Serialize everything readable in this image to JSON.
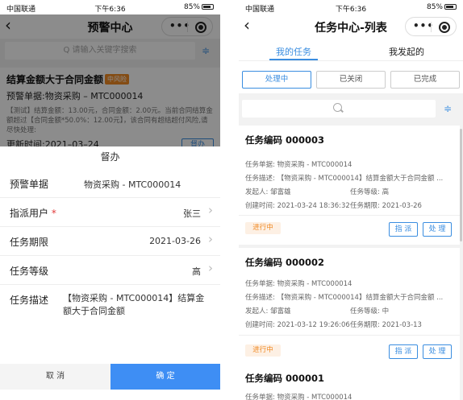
{
  "left": {
    "status": {
      "carrier": "中国联通",
      "time": "下午6:36",
      "right": "85%"
    },
    "nav": {
      "back": "‹",
      "title": "预警中心"
    },
    "search": {
      "placeholder": "Q 请输入关键字搜索"
    },
    "card": {
      "title": "结算金额大于合同金额",
      "tag": "中风险",
      "doc": "预警单据:物资采购 – MTC000014",
      "desc": "【测试】结算金额：13.00元，合同金额：2.00元。当前合同结算金额超过【合同金额*50.0%：12.00元】，该合同有超结超付风险,请尽快处理:",
      "updated": "更新时间:2021–03–24",
      "btn": "督办"
    },
    "sheet": {
      "title": "督办",
      "rows": [
        {
          "label": "预警单据",
          "value": "物资采购 - MTC000014"
        },
        {
          "label": "指派用户",
          "required": "*",
          "value": "张三"
        },
        {
          "label": "任务期限",
          "value": "2021-03-26"
        },
        {
          "label": "任务等级",
          "value": "高"
        },
        {
          "label": "任务描述",
          "value": "【物资采购 - MTC000014】结算金额大于合同金额"
        }
      ],
      "cancel": "取 消",
      "confirm": "确 定"
    }
  },
  "right": {
    "status": {
      "carrier": "中国联通",
      "time": "下午6:36",
      "right": "85%"
    },
    "nav": {
      "back": "‹",
      "title": "任务中心-列表"
    },
    "tabs": [
      "我的任务",
      "我发起的"
    ],
    "segments": [
      "处理中",
      "已关闭",
      "已完成"
    ],
    "tasks": [
      {
        "code": "任务编码 000003",
        "doc": "任务单据: 物资采购 - MTC000014",
        "desc": "任务描述: 【物资采购 - MTC000014】结算金额大于合同金额 ...",
        "initiator": "发起人: 邹富雄",
        "level": "任务等级: 高",
        "created": "创建时间: 2021-03-24 18:36:32",
        "deadline": "任务期限: 2021-03-26",
        "state": "进行中",
        "assign": "指 派",
        "handle": "处 理"
      },
      {
        "code": "任务编码 000002",
        "doc": "任务单据: 物资采购 - MTC000014",
        "desc": "任务描述: 【物资采购 - MTC000014】结算金额大于合同金额 ...",
        "initiator": "发起人: 邹富雄",
        "level": "任务等级: 中",
        "created": "创建时间: 2021-03-12 19:26:06",
        "deadline": "任务期限: 2021-03-13",
        "state": "进行中",
        "assign": "指 派",
        "handle": "处 理"
      },
      {
        "code": "任务编码 000001",
        "doc": "任务单据: 物资采购 - MTC000014"
      }
    ]
  },
  "colors": {
    "accent": "#3a8de0",
    "confirm": "#3e8ef4",
    "warning": "#f08a24",
    "required": "#e23b3b"
  }
}
